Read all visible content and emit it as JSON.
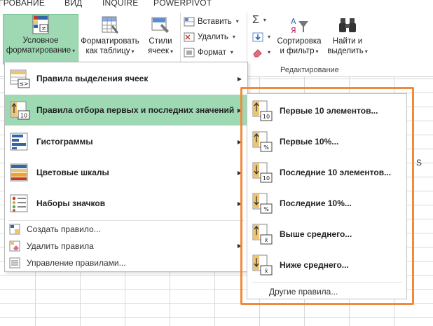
{
  "tabs": [
    "ГРОВАНИЕ",
    "ВИД",
    "INQUIRE",
    "POWERPIVOT"
  ],
  "ribbon": {
    "cond_format": [
      "Условное",
      "форматирование"
    ],
    "format_table": [
      "Форматировать",
      "как таблицу"
    ],
    "cell_styles": [
      "Стили",
      "ячеек"
    ],
    "insert": "Вставить",
    "delete": "Удалить",
    "format": "Формат",
    "sort_filter": [
      "Сортировка",
      "и фильтр"
    ],
    "find_select": [
      "Найти и",
      "выделить"
    ],
    "editing_group": "Редактирование"
  },
  "menu": {
    "items": [
      {
        "label": "Правила выделения ячеек",
        "icon": "highlight-cells-rules-icon"
      },
      {
        "label": "Правила отбора первых и последних значений",
        "icon": "top-bottom-rules-icon"
      },
      {
        "label": "Гистограммы",
        "icon": "data-bars-icon"
      },
      {
        "label": "Цветовые шкалы",
        "icon": "color-scales-icon"
      },
      {
        "label": "Наборы значков",
        "icon": "icon-sets-icon"
      }
    ],
    "simple": [
      {
        "label": "Создать правило..."
      },
      {
        "label": "Удалить правила"
      },
      {
        "label": "Управление правилами..."
      }
    ]
  },
  "submenu": {
    "items": [
      {
        "label": "Первые 10 элементов...",
        "badge": "10"
      },
      {
        "label": "Первые 10%...",
        "badge": "%"
      },
      {
        "label": "Последние 10 элементов...",
        "badge": "10"
      },
      {
        "label": "Последние 10%...",
        "badge": "%"
      },
      {
        "label": "Выше среднего...",
        "badge": "x̄"
      },
      {
        "label": "Ниже среднего...",
        "badge": "x̄"
      }
    ],
    "other": "Другие правила..."
  },
  "grid": {
    "column_letter": "S"
  },
  "colors": {
    "highlight": "#9ed9b3",
    "callout": "#f08a3c"
  }
}
